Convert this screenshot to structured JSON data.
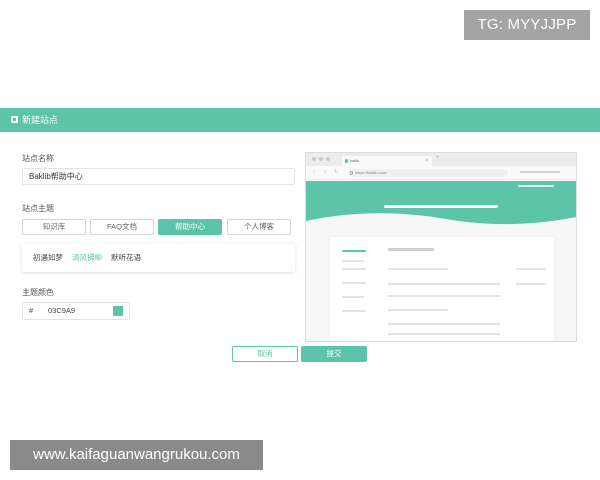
{
  "badge": {
    "text": "TG: MYYJJPP"
  },
  "dialog": {
    "title": "新建站点",
    "site_name": {
      "label": "站点名称",
      "value": "Baklib帮助中心"
    },
    "theme": {
      "label": "站点主题",
      "options": [
        {
          "label": "知识库",
          "active": false
        },
        {
          "label": "FAQ文档",
          "active": false
        },
        {
          "label": "帮助中心",
          "active": true
        },
        {
          "label": "个人博客",
          "active": false
        }
      ],
      "variants": [
        {
          "label": "初遇如梦",
          "selected": false
        },
        {
          "label": "清风拂柳",
          "selected": true
        },
        {
          "label": "默听花语",
          "selected": false
        }
      ]
    },
    "theme_color": {
      "label": "主题颜色",
      "hash": "#",
      "value": "03C9A9",
      "swatch_color": "#5cc4a8"
    },
    "buttons": {
      "cancel": "取消",
      "submit": "提交"
    }
  },
  "preview": {
    "tab_title": "baklib",
    "tab_close": "×",
    "new_tab": "+",
    "url": "https://baklib.com/",
    "nav": {
      "back": "‹",
      "forward": "›",
      "reload": "↻"
    }
  },
  "watermark": {
    "text": "www.kaifaguanwangrukou.com"
  },
  "colors": {
    "accent": "#5cc4a8",
    "badge_bg": "#a4a4a4",
    "watermark_bg": "#8a8a8a"
  }
}
